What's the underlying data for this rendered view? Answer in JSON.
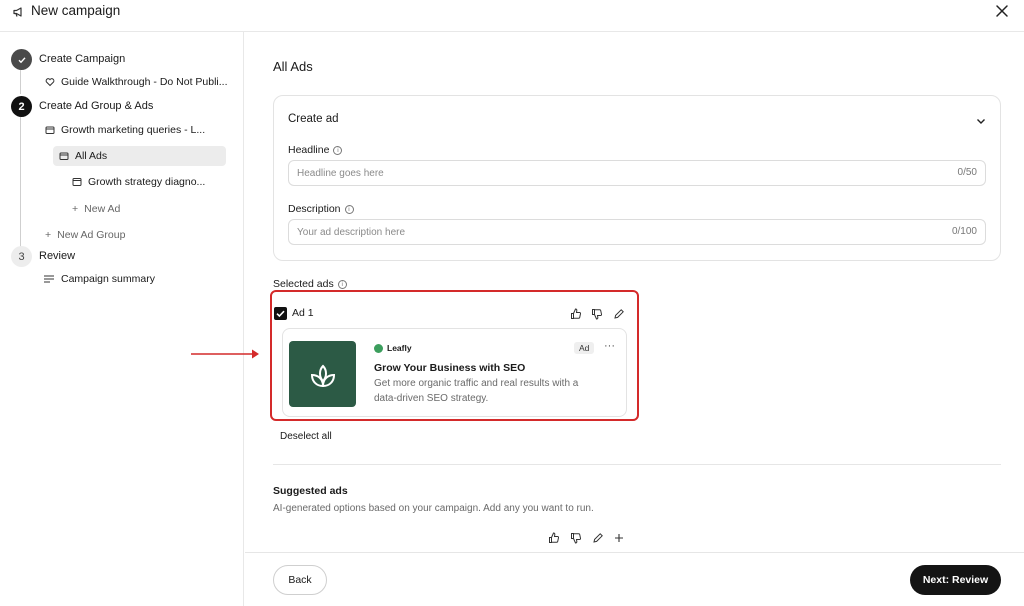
{
  "header": {
    "title": "New campaign",
    "icon": "megaphone-icon",
    "close_icon": "close-icon"
  },
  "sidebar": {
    "steps": [
      {
        "number": "",
        "label": "Create Campaign",
        "state": "done"
      },
      {
        "number": "2",
        "label": "Create Ad Group & Ads",
        "state": "active"
      },
      {
        "number": "3",
        "label": "Review",
        "state": "pending"
      }
    ],
    "items": {
      "guide": "Guide Walkthrough - Do Not Publi...",
      "ad_group": "Growth marketing queries - L...",
      "all_ads": "All Ads",
      "growth_strategy": "Growth strategy diagno...",
      "new_ad": "New Ad",
      "new_ad_group": "New Ad Group",
      "campaign_summary": "Campaign summary"
    }
  },
  "main": {
    "title": "All Ads",
    "create_ad": {
      "title": "Create ad",
      "headline_label": "Headline",
      "headline_placeholder": "Headline goes here",
      "headline_counter": "0/50",
      "description_label": "Description",
      "description_placeholder": "Your ad description here",
      "description_counter": "0/100"
    },
    "selected_ads": {
      "label": "Selected ads",
      "ad_name": "Ad 1",
      "ad": {
        "brand": "Leafly",
        "badge": "Ad",
        "more": "···",
        "headline": "Grow Your Business with SEO",
        "description": "Get more organic traffic and real results with a data-driven SEO strategy."
      },
      "deselect_all": "Deselect all"
    },
    "suggested": {
      "title": "Suggested ads",
      "subtitle": "AI-generated options based on your campaign. Add any you want to run."
    }
  },
  "footer": {
    "back": "Back",
    "next": "Next: Review"
  },
  "colors": {
    "highlight": "#d42a2a",
    "thumb": "#2c5a45",
    "brand_dot": "#3c9e5d",
    "primary_button": "#141414"
  }
}
